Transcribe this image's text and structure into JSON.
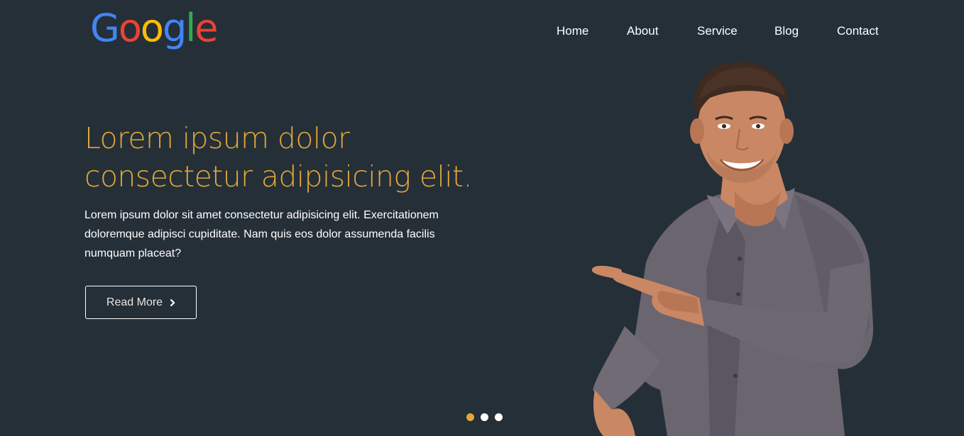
{
  "header": {
    "logo": {
      "text": "Google",
      "letters": [
        "G",
        "o",
        "o",
        "g",
        "l",
        "e"
      ],
      "colors": [
        "#4285f4",
        "#ea4335",
        "#fbbc05",
        "#4285f4",
        "#34a853",
        "#ea4335"
      ]
    },
    "nav": [
      {
        "label": "Home"
      },
      {
        "label": "About"
      },
      {
        "label": "Service"
      },
      {
        "label": "Blog"
      },
      {
        "label": "Contact"
      }
    ]
  },
  "hero": {
    "headline_line1": "Lorem ipsum dolor",
    "headline_line2": "consectetur adipisicing elit.",
    "description": "Lorem ipsum dolor sit amet consectetur adipisicing elit. Exercitationem doloremque adipisci cupiditate. Nam quis eos dolor assumenda facilis numquam placeat?",
    "button_label": "Read More",
    "button_icon": "chevron-right-icon"
  },
  "slider": {
    "total": 3,
    "active": 1
  },
  "colors": {
    "background": "#252f37",
    "accent": "#e1a83a",
    "text": "#ffffff"
  }
}
